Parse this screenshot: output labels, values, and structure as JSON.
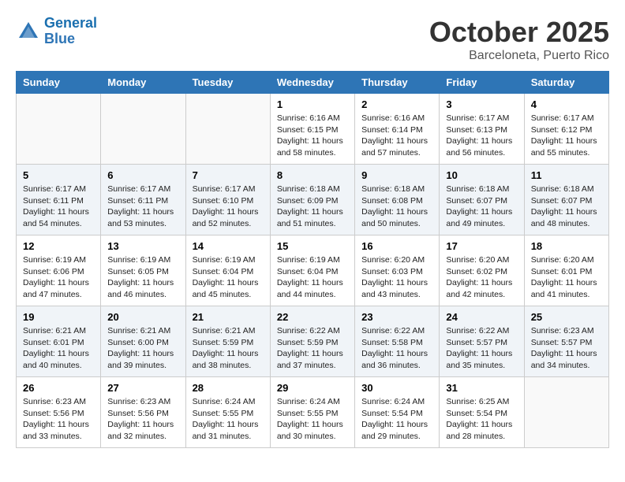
{
  "header": {
    "logo_line1": "General",
    "logo_line2": "Blue",
    "month_title": "October 2025",
    "subtitle": "Barceloneta, Puerto Rico"
  },
  "days_of_week": [
    "Sunday",
    "Monday",
    "Tuesday",
    "Wednesday",
    "Thursday",
    "Friday",
    "Saturday"
  ],
  "weeks": [
    [
      {
        "day": "",
        "info": ""
      },
      {
        "day": "",
        "info": ""
      },
      {
        "day": "",
        "info": ""
      },
      {
        "day": "1",
        "info": "Sunrise: 6:16 AM\nSunset: 6:15 PM\nDaylight: 11 hours\nand 58 minutes."
      },
      {
        "day": "2",
        "info": "Sunrise: 6:16 AM\nSunset: 6:14 PM\nDaylight: 11 hours\nand 57 minutes."
      },
      {
        "day": "3",
        "info": "Sunrise: 6:17 AM\nSunset: 6:13 PM\nDaylight: 11 hours\nand 56 minutes."
      },
      {
        "day": "4",
        "info": "Sunrise: 6:17 AM\nSunset: 6:12 PM\nDaylight: 11 hours\nand 55 minutes."
      }
    ],
    [
      {
        "day": "5",
        "info": "Sunrise: 6:17 AM\nSunset: 6:11 PM\nDaylight: 11 hours\nand 54 minutes."
      },
      {
        "day": "6",
        "info": "Sunrise: 6:17 AM\nSunset: 6:11 PM\nDaylight: 11 hours\nand 53 minutes."
      },
      {
        "day": "7",
        "info": "Sunrise: 6:17 AM\nSunset: 6:10 PM\nDaylight: 11 hours\nand 52 minutes."
      },
      {
        "day": "8",
        "info": "Sunrise: 6:18 AM\nSunset: 6:09 PM\nDaylight: 11 hours\nand 51 minutes."
      },
      {
        "day": "9",
        "info": "Sunrise: 6:18 AM\nSunset: 6:08 PM\nDaylight: 11 hours\nand 50 minutes."
      },
      {
        "day": "10",
        "info": "Sunrise: 6:18 AM\nSunset: 6:07 PM\nDaylight: 11 hours\nand 49 minutes."
      },
      {
        "day": "11",
        "info": "Sunrise: 6:18 AM\nSunset: 6:07 PM\nDaylight: 11 hours\nand 48 minutes."
      }
    ],
    [
      {
        "day": "12",
        "info": "Sunrise: 6:19 AM\nSunset: 6:06 PM\nDaylight: 11 hours\nand 47 minutes."
      },
      {
        "day": "13",
        "info": "Sunrise: 6:19 AM\nSunset: 6:05 PM\nDaylight: 11 hours\nand 46 minutes."
      },
      {
        "day": "14",
        "info": "Sunrise: 6:19 AM\nSunset: 6:04 PM\nDaylight: 11 hours\nand 45 minutes."
      },
      {
        "day": "15",
        "info": "Sunrise: 6:19 AM\nSunset: 6:04 PM\nDaylight: 11 hours\nand 44 minutes."
      },
      {
        "day": "16",
        "info": "Sunrise: 6:20 AM\nSunset: 6:03 PM\nDaylight: 11 hours\nand 43 minutes."
      },
      {
        "day": "17",
        "info": "Sunrise: 6:20 AM\nSunset: 6:02 PM\nDaylight: 11 hours\nand 42 minutes."
      },
      {
        "day": "18",
        "info": "Sunrise: 6:20 AM\nSunset: 6:01 PM\nDaylight: 11 hours\nand 41 minutes."
      }
    ],
    [
      {
        "day": "19",
        "info": "Sunrise: 6:21 AM\nSunset: 6:01 PM\nDaylight: 11 hours\nand 40 minutes."
      },
      {
        "day": "20",
        "info": "Sunrise: 6:21 AM\nSunset: 6:00 PM\nDaylight: 11 hours\nand 39 minutes."
      },
      {
        "day": "21",
        "info": "Sunrise: 6:21 AM\nSunset: 5:59 PM\nDaylight: 11 hours\nand 38 minutes."
      },
      {
        "day": "22",
        "info": "Sunrise: 6:22 AM\nSunset: 5:59 PM\nDaylight: 11 hours\nand 37 minutes."
      },
      {
        "day": "23",
        "info": "Sunrise: 6:22 AM\nSunset: 5:58 PM\nDaylight: 11 hours\nand 36 minutes."
      },
      {
        "day": "24",
        "info": "Sunrise: 6:22 AM\nSunset: 5:57 PM\nDaylight: 11 hours\nand 35 minutes."
      },
      {
        "day": "25",
        "info": "Sunrise: 6:23 AM\nSunset: 5:57 PM\nDaylight: 11 hours\nand 34 minutes."
      }
    ],
    [
      {
        "day": "26",
        "info": "Sunrise: 6:23 AM\nSunset: 5:56 PM\nDaylight: 11 hours\nand 33 minutes."
      },
      {
        "day": "27",
        "info": "Sunrise: 6:23 AM\nSunset: 5:56 PM\nDaylight: 11 hours\nand 32 minutes."
      },
      {
        "day": "28",
        "info": "Sunrise: 6:24 AM\nSunset: 5:55 PM\nDaylight: 11 hours\nand 31 minutes."
      },
      {
        "day": "29",
        "info": "Sunrise: 6:24 AM\nSunset: 5:55 PM\nDaylight: 11 hours\nand 30 minutes."
      },
      {
        "day": "30",
        "info": "Sunrise: 6:24 AM\nSunset: 5:54 PM\nDaylight: 11 hours\nand 29 minutes."
      },
      {
        "day": "31",
        "info": "Sunrise: 6:25 AM\nSunset: 5:54 PM\nDaylight: 11 hours\nand 28 minutes."
      },
      {
        "day": "",
        "info": ""
      }
    ]
  ]
}
